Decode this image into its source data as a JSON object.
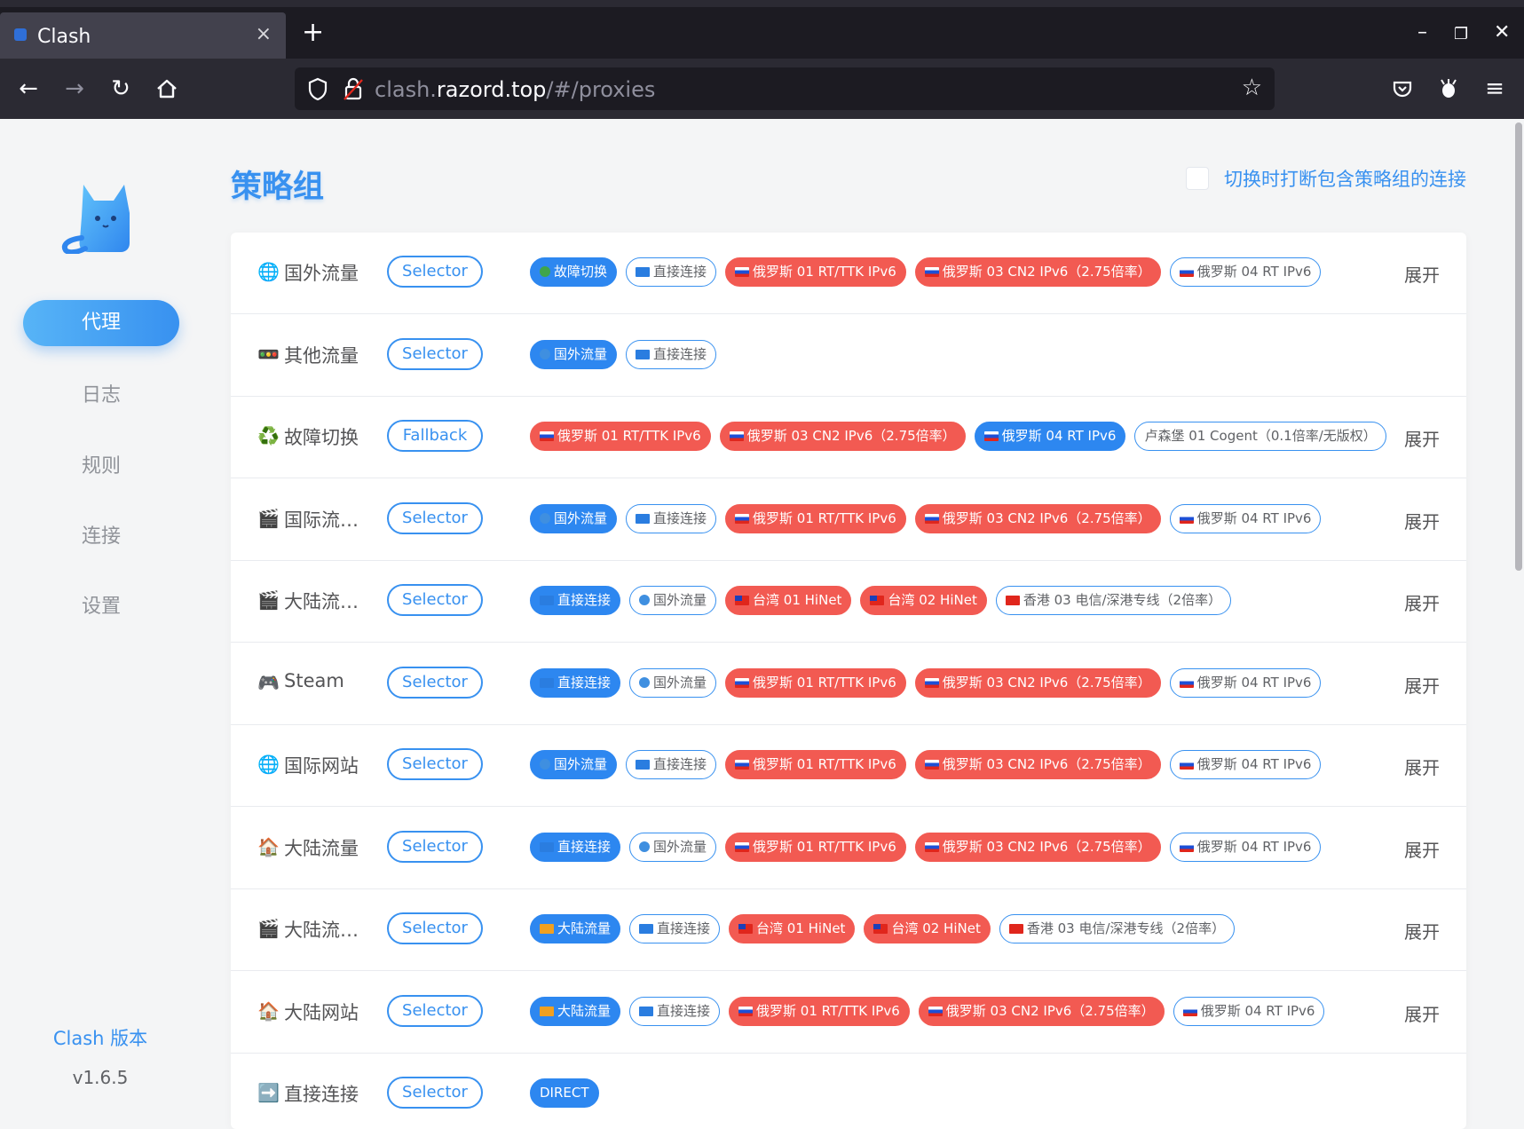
{
  "browser": {
    "tab_title": "Clash",
    "tab_close": "×",
    "new_tab": "+",
    "window": {
      "minimize": "–",
      "restore": "❐",
      "close": "✕"
    },
    "url_host_prefix": "clash.",
    "url_host": "razord.top",
    "url_path": "/#/proxies"
  },
  "sidebar": {
    "items": [
      {
        "label": "代理",
        "active": true
      },
      {
        "label": "日志"
      },
      {
        "label": "规则"
      },
      {
        "label": "连接"
      },
      {
        "label": "设置"
      }
    ],
    "version_label": "Clash 版本",
    "version_value": "v1.6.5"
  },
  "header": {
    "title": "策略组",
    "toggle_label": "切换时打断包含策略组的连接"
  },
  "expand_label": "展开",
  "groups": [
    {
      "icon": "globe-icon",
      "name": "国外流量",
      "type": "Selector",
      "expand": true,
      "tags": [
        {
          "flag": "recycle",
          "label": "故障切换",
          "style": "selected"
        },
        {
          "flag": "arrow",
          "label": "直接连接"
        },
        {
          "flag": "ru",
          "label": "俄罗斯 01 RT/TTK IPv6",
          "style": "red"
        },
        {
          "flag": "ru",
          "label": "俄罗斯 03 CN2 IPv6（2.75倍率）",
          "style": "red"
        },
        {
          "flag": "ru",
          "label": "俄罗斯 04 RT IPv6"
        }
      ]
    },
    {
      "icon": "traffic-light-icon",
      "name": "其他流量",
      "type": "Selector",
      "expand": false,
      "tags": [
        {
          "flag": "globe",
          "label": "国外流量",
          "style": "selected"
        },
        {
          "flag": "arrow",
          "label": "直接连接"
        }
      ]
    },
    {
      "icon": "recycle-icon",
      "name": "故障切换",
      "type": "Fallback",
      "expand": true,
      "tags": [
        {
          "flag": "ru",
          "label": "俄罗斯 01 RT/TTK IPv6",
          "style": "red"
        },
        {
          "flag": "ru",
          "label": "俄罗斯 03 CN2 IPv6（2.75倍率）",
          "style": "red"
        },
        {
          "flag": "ru",
          "label": "俄罗斯 04 RT IPv6",
          "style": "selected"
        },
        {
          "flag": "",
          "label": "卢森堡 01 Cogent（0.1倍率/无版权）"
        }
      ]
    },
    {
      "icon": "clapper-icon",
      "name": "国际流…",
      "type": "Selector",
      "expand": true,
      "tags": [
        {
          "flag": "globe",
          "label": "国外流量",
          "style": "selected"
        },
        {
          "flag": "arrow",
          "label": "直接连接"
        },
        {
          "flag": "ru",
          "label": "俄罗斯 01 RT/TTK IPv6",
          "style": "red"
        },
        {
          "flag": "ru",
          "label": "俄罗斯 03 CN2 IPv6（2.75倍率）",
          "style": "red"
        },
        {
          "flag": "ru",
          "label": "俄罗斯 04 RT IPv6"
        }
      ]
    },
    {
      "icon": "clapper-icon",
      "name": "大陆流…",
      "type": "Selector",
      "expand": true,
      "tags": [
        {
          "flag": "arrow",
          "label": "直接连接",
          "style": "selected"
        },
        {
          "flag": "globe",
          "label": "国外流量"
        },
        {
          "flag": "tw",
          "label": "台湾 01 HiNet",
          "style": "red"
        },
        {
          "flag": "tw",
          "label": "台湾 02 HiNet",
          "style": "red"
        },
        {
          "flag": "hk",
          "label": "香港 03 电信/深港专线（2倍率）"
        }
      ]
    },
    {
      "icon": "gamepad-icon",
      "name": "Steam",
      "type": "Selector",
      "expand": true,
      "tags": [
        {
          "flag": "arrow",
          "label": "直接连接",
          "style": "selected"
        },
        {
          "flag": "globe",
          "label": "国外流量"
        },
        {
          "flag": "ru",
          "label": "俄罗斯 01 RT/TTK IPv6",
          "style": "red"
        },
        {
          "flag": "ru",
          "label": "俄罗斯 03 CN2 IPv6（2.75倍率）",
          "style": "red"
        },
        {
          "flag": "ru",
          "label": "俄罗斯 04 RT IPv6"
        }
      ]
    },
    {
      "icon": "globe-icon",
      "name": "国际网站",
      "type": "Selector",
      "expand": true,
      "tags": [
        {
          "flag": "globe",
          "label": "国外流量",
          "style": "selected"
        },
        {
          "flag": "arrow",
          "label": "直接连接"
        },
        {
          "flag": "ru",
          "label": "俄罗斯 01 RT/TTK IPv6",
          "style": "red"
        },
        {
          "flag": "ru",
          "label": "俄罗斯 03 CN2 IPv6（2.75倍率）",
          "style": "red"
        },
        {
          "flag": "ru",
          "label": "俄罗斯 04 RT IPv6"
        }
      ]
    },
    {
      "icon": "house-icon",
      "name": "大陆流量",
      "type": "Selector",
      "expand": true,
      "tags": [
        {
          "flag": "arrow",
          "label": "直接连接",
          "style": "selected"
        },
        {
          "flag": "globe",
          "label": "国外流量"
        },
        {
          "flag": "ru",
          "label": "俄罗斯 01 RT/TTK IPv6",
          "style": "red"
        },
        {
          "flag": "ru",
          "label": "俄罗斯 03 CN2 IPv6（2.75倍率）",
          "style": "red"
        },
        {
          "flag": "ru",
          "label": "俄罗斯 04 RT IPv6"
        }
      ]
    },
    {
      "icon": "clapper-icon",
      "name": "大陆流…",
      "type": "Selector",
      "expand": true,
      "tags": [
        {
          "flag": "house",
          "label": "大陆流量",
          "style": "selected"
        },
        {
          "flag": "arrow",
          "label": "直接连接"
        },
        {
          "flag": "tw",
          "label": "台湾 01 HiNet",
          "style": "red"
        },
        {
          "flag": "tw",
          "label": "台湾 02 HiNet",
          "style": "red"
        },
        {
          "flag": "hk",
          "label": "香港 03 电信/深港专线（2倍率）"
        }
      ]
    },
    {
      "icon": "house-icon",
      "name": "大陆网站",
      "type": "Selector",
      "expand": true,
      "tags": [
        {
          "flag": "house",
          "label": "大陆流量",
          "style": "selected"
        },
        {
          "flag": "arrow",
          "label": "直接连接"
        },
        {
          "flag": "ru",
          "label": "俄罗斯 01 RT/TTK IPv6",
          "style": "red"
        },
        {
          "flag": "ru",
          "label": "俄罗斯 03 CN2 IPv6（2.75倍率）",
          "style": "red"
        },
        {
          "flag": "ru",
          "label": "俄罗斯 04 RT IPv6"
        }
      ]
    },
    {
      "icon": "arrow-right-icon",
      "name": "直接连接",
      "type": "Selector",
      "expand": false,
      "tags": [
        {
          "flag": "",
          "label": "DIRECT",
          "style": "selected"
        }
      ]
    }
  ],
  "colors": {
    "accent": "#3891f0",
    "danger": "#f25a52",
    "selected": "#2d87f0"
  }
}
